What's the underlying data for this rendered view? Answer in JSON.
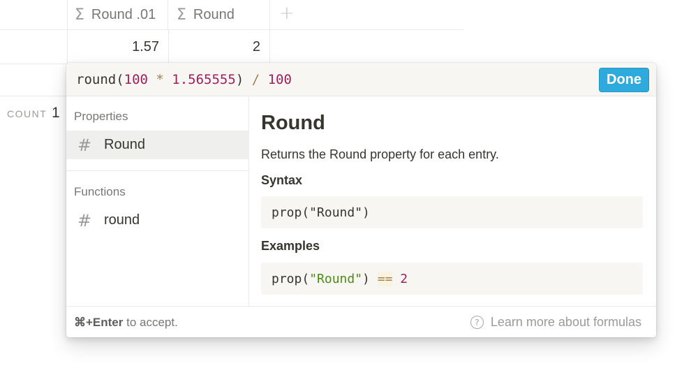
{
  "table": {
    "columns": [
      {
        "icon": "sigma-icon",
        "glyph": "Σ",
        "label": "Round .01"
      },
      {
        "icon": "sigma-icon",
        "glyph": "Σ",
        "label": "Round"
      }
    ],
    "add_column_glyph": "+",
    "row": [
      "1.57",
      "2"
    ],
    "count_label": "COUNT",
    "count_value": "1"
  },
  "popup": {
    "formula": {
      "fn": "round(",
      "n1": "100",
      "op1": " * ",
      "n2": "1.565555",
      "close": ") ",
      "op2": "/",
      "sp": " ",
      "n3": "100"
    },
    "done_label": "Done",
    "sections": {
      "properties_label": "Properties",
      "functions_label": "Functions",
      "property_items": [
        {
          "icon": "hash-icon",
          "glyph": "#",
          "label": "Round"
        }
      ],
      "function_items": [
        {
          "icon": "hash-icon",
          "glyph": "#",
          "label": "round"
        }
      ]
    },
    "doc": {
      "title": "Round",
      "description": "Returns the Round property for each entry.",
      "syntax_heading": "Syntax",
      "syntax_code": "prop(\"Round\")",
      "examples_heading": "Examples",
      "example": {
        "fn": "prop(",
        "str": "\"Round\"",
        "close": ") ",
        "op": "==",
        "sp": " ",
        "num": "2"
      }
    },
    "footer": {
      "hint_key": "⌘+Enter",
      "hint_text": " to accept.",
      "help_glyph": "?",
      "learn_more": "Learn more about formulas"
    }
  },
  "colors": {
    "accent": "#2eaadc",
    "number": "#a01f5a",
    "operator": "#a2804a",
    "string": "#4d8b15"
  }
}
